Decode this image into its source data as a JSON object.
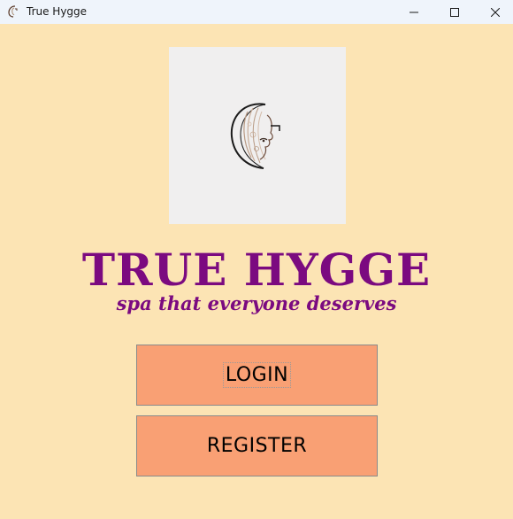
{
  "window": {
    "title": "True Hygge",
    "icons": [
      "app-icon",
      "minimize-icon",
      "maximize-icon",
      "close-icon"
    ]
  },
  "brand": {
    "title": "TRUE HYGGE",
    "tagline": "spa that everyone deserves",
    "color": "#7b0a80",
    "logo_icon": "spa-woman-face-logo"
  },
  "buttons": {
    "login_label": "LOGIN",
    "register_label": "REGISTER",
    "color": "#f9a074"
  },
  "colors": {
    "background": "#fce4b4",
    "titlebar": "#eff4fb",
    "logo_box": "#f0efef"
  }
}
